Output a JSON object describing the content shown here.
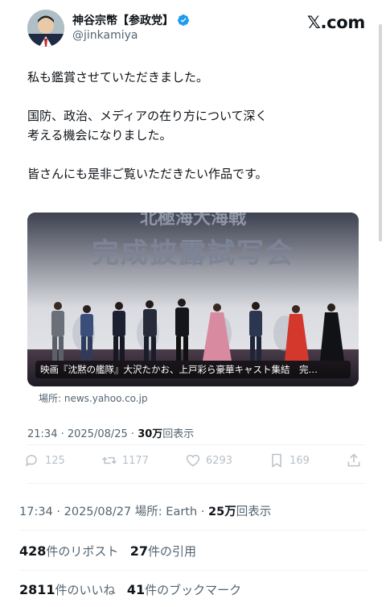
{
  "header": {
    "display_name": "神谷宗幣【参政党】",
    "handle": "@jinkamiya",
    "site_logo": "𝕏.com"
  },
  "tweet": {
    "paragraphs": [
      "私も鑑賞させていただきました。",
      "国防、政治、メディアの在り方について深く考える機会になりました。",
      "皆さんにも是非ご覧いただきたい作品です。"
    ]
  },
  "card": {
    "banner_text_top": "北極海大海戦",
    "banner_text_main": "完成披露試写会",
    "caption": "映画『沈黙の艦隊』大沢たかお、上戸彩ら豪華キャスト集結　完…",
    "source": "場所: news.yahoo.co.jp"
  },
  "quoted_meta": {
    "time": "21:34 · 2025/08/25 · ",
    "views_number": "30万",
    "views_label": "回表示"
  },
  "actions": {
    "reply_count": "125",
    "retweet_count": "1177",
    "like_count": "6293",
    "bookmark_count": "169"
  },
  "outer_meta": {
    "time": "17:34 · 2025/08/27 場所: Earth · ",
    "views_number": "25万",
    "views_label": "回表示"
  },
  "stats": {
    "reposts_number": "428",
    "reposts_label": "件のリポスト",
    "quotes_number": "27",
    "quotes_label": "件の引用",
    "likes_number": "2811",
    "likes_label": "件のいいね",
    "bookmarks_number": "41",
    "bookmarks_label": "件のブックマーク"
  },
  "colors": {
    "verified_blue": "#1d9bf0",
    "muted_text": "#536471",
    "main_text": "#0f1419"
  }
}
